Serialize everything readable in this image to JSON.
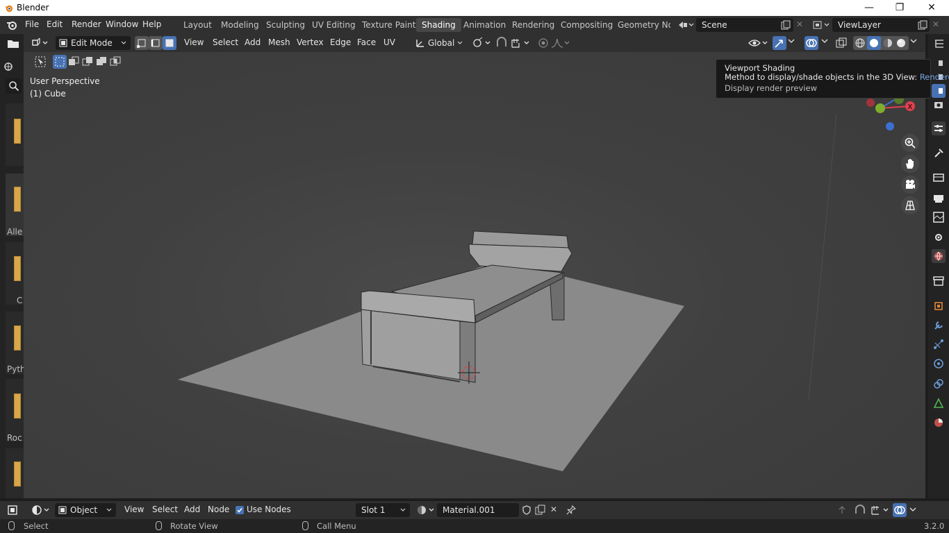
{
  "os_window": {
    "title": "Blender",
    "minimize": "—",
    "maximize": "❐",
    "close": "✕"
  },
  "topbar": {
    "menus": [
      "File",
      "Edit",
      "Render",
      "Window",
      "Help"
    ],
    "workspace_tabs": [
      {
        "label": "Layout",
        "active": false
      },
      {
        "label": "Modeling",
        "active": false
      },
      {
        "label": "Sculpting",
        "active": false
      },
      {
        "label": "UV Editing",
        "active": false
      },
      {
        "label": "Texture Paint",
        "active": false
      },
      {
        "label": "Shading",
        "active": true
      },
      {
        "label": "Animation",
        "active": false
      },
      {
        "label": "Rendering",
        "active": false
      },
      {
        "label": "Compositing",
        "active": false
      },
      {
        "label": "Geometry Noc",
        "active": false
      }
    ],
    "scene_name": "Scene",
    "view_layer_name": "ViewLayer"
  },
  "viewport_header": {
    "mode": "Edit Mode",
    "menus": [
      "View",
      "Select",
      "Add",
      "Mesh",
      "Vertex",
      "Edge",
      "Face",
      "UV"
    ],
    "transform_orientation": "Global"
  },
  "viewport": {
    "perspective_label": "User Perspective",
    "object_label": "(1) Cube",
    "gizmo_x_label": "X"
  },
  "tooltip": {
    "title": "Viewport Shading",
    "description": "Method to display/shade objects in the 3D View:",
    "value": "Rendered",
    "detail": "Display render preview"
  },
  "left_panel": {
    "tab_labels": [
      "Alle",
      "C",
      "Pyth",
      "Roc"
    ]
  },
  "node_header": {
    "object_type": "Object",
    "menus": [
      "View",
      "Select",
      "Add",
      "Node"
    ],
    "use_nodes_label": "Use Nodes",
    "use_nodes_checked": true,
    "slot": "Slot 1",
    "material_name": "Material.001"
  },
  "statusbar": {
    "select_label": "Select",
    "rotate_label": "Rotate View",
    "call_menu_label": "Call Menu",
    "version": "3.2.0"
  },
  "colors": {
    "accent_blue": "#4772b3",
    "x_axis_red": "#e0404f",
    "y_axis_green": "#7fae2d",
    "z_axis_blue": "#3d6fd1"
  }
}
